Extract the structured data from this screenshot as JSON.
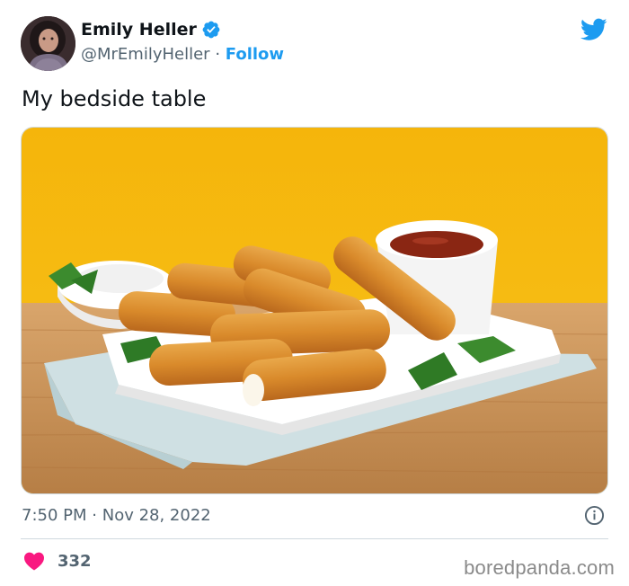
{
  "author": {
    "name": "Emily Heller",
    "handle": "@MrEmilyHeller",
    "separator": "·",
    "follow_label": "Follow",
    "verified_icon": "verified-badge-icon"
  },
  "tweet": {
    "text": "My bedside table",
    "time": "7:50 PM",
    "separator": "·",
    "date": "Nov 28, 2022",
    "likes": "332"
  },
  "watermark": "boredpanda.com",
  "colors": {
    "twitter_blue": "#1d9bf0",
    "like_pink": "#f91880",
    "secondary_text": "#536471"
  },
  "icons": [
    "twitter-bird-icon",
    "verified-badge-icon",
    "info-icon",
    "heart-icon"
  ]
}
